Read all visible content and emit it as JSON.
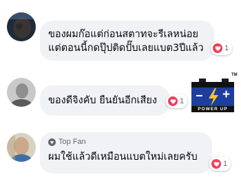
{
  "comments": [
    {
      "text_line1": "ของผมก๊อแต่ก่อนสตาทจะรีเลหน่อย",
      "text_line2": "แต่ตอนนี้กดปุ๊ปติดปั๊บเลยแบต3ปีแล้ว",
      "reaction": "heart-icon",
      "reaction_count": "1"
    },
    {
      "text": "ของดีจิงคับ ยืนยันอีกเสียง",
      "reaction": "heart-icon",
      "reaction_count": "1",
      "attached_image": {
        "logo_text": "POWER UP",
        "trademark": "TM",
        "minus": "−",
        "plus": "+"
      }
    },
    {
      "badge_label": "Top Fan",
      "text": "ผมใช้แล้วดีเหมือนแบตใหม่เลยครับ",
      "reaction": "heart-icon",
      "reaction_count": "1"
    }
  ],
  "colors": {
    "bubble": "#f0f2f5",
    "heart": "#f33e58",
    "battery_body": "#1d3e9e",
    "bolt": "#f7c51e"
  }
}
